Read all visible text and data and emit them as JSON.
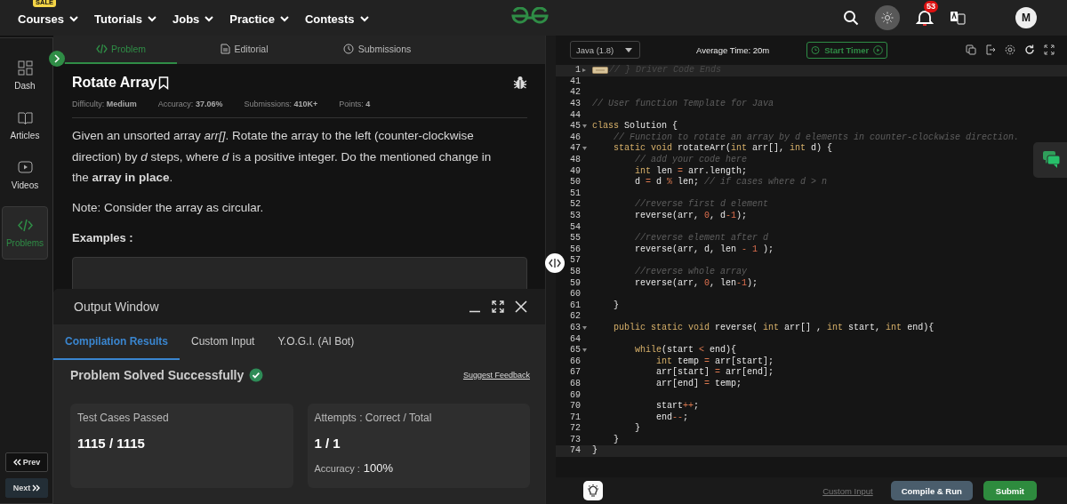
{
  "top_nav": {
    "menus": [
      {
        "label": "Courses",
        "badge": "SALE"
      },
      {
        "label": "Tutorials"
      },
      {
        "label": "Jobs"
      },
      {
        "label": "Practice"
      },
      {
        "label": "Contests"
      }
    ],
    "notification_count": "53",
    "avatar": "M"
  },
  "sidebar": {
    "items": [
      {
        "label": "Dash",
        "selected": false
      },
      {
        "label": "Articles",
        "selected": false
      },
      {
        "label": "Videos",
        "selected": false
      },
      {
        "label": "Problems",
        "selected": true
      }
    ],
    "prev": "Prev",
    "next": "Next"
  },
  "problem": {
    "tabs": [
      {
        "label": "Problem",
        "selected": true
      },
      {
        "label": "Editorial",
        "selected": false
      },
      {
        "label": "Submissions",
        "selected": false
      }
    ],
    "title": "Rotate Array",
    "meta": [
      {
        "label": "Difficulty:",
        "value": "Medium"
      },
      {
        "label": "Accuracy:",
        "value": "37.06%"
      },
      {
        "label": "Submissions:",
        "value": "410K+"
      },
      {
        "label": "Points:",
        "value": "4"
      }
    ],
    "paragraphs": [
      "Given an unsorted array *arr[]*. Rotate the array to the left (counter-clockwise direction) by *d* steps, where *d* is a positive integer. Do the mentioned change in the **array in place**.",
      "Note: Consider the array as circular."
    ],
    "examples_heading": "Examples :"
  },
  "output_window": {
    "title": "Output Window",
    "tabs": [
      {
        "label": "Compilation Results",
        "selected": true
      },
      {
        "label": "Custom Input",
        "selected": false
      },
      {
        "label": "Y.O.G.I. (AI Bot)",
        "selected": false
      }
    ],
    "status": "Problem Solved Successfully",
    "feedback_link": "Suggest Feedback",
    "cards": [
      {
        "heading": "Test Cases Passed",
        "value": "1115 / 1115"
      },
      {
        "heading": "Attempts : Correct / Total",
        "value": "1 / 1",
        "detail_label": "Accuracy :",
        "detail_value": "100%"
      }
    ]
  },
  "editor": {
    "language": "Java (1.8)",
    "average_time": "Average Time: 20m",
    "timer_button": "Start Timer",
    "lines": [
      {
        "number": "1",
        "fold": true,
        "folded": true,
        "highlighted": true,
        "tokens": [
          {
            "kind": "comment",
            "text": "// } Driver Code Ends"
          }
        ]
      },
      {
        "number": "41",
        "fold": false,
        "highlighted": false
      },
      {
        "number": "42",
        "fold": false,
        "highlighted": false
      },
      {
        "number": "43",
        "fold": false,
        "highlighted": false,
        "tokens": [
          {
            "kind": "comment",
            "text": "// User function Template for Java"
          }
        ]
      },
      {
        "number": "44",
        "fold": false,
        "highlighted": false
      },
      {
        "number": "45",
        "fold": true,
        "highlighted": false,
        "tokens": [
          {
            "kind": "keyword",
            "text": "class"
          },
          {
            "kind": "plain",
            "text": " Solution {"
          }
        ]
      },
      {
        "number": "46",
        "fold": false,
        "highlighted": false,
        "tokens": [
          {
            "kind": "comment",
            "text": "    // Function to rotate an array by d elements in counter-clockwise direction."
          }
        ]
      },
      {
        "number": "47",
        "fold": true,
        "highlighted": false,
        "tokens": [
          {
            "kind": "keyword",
            "text": "    static void"
          },
          {
            "kind": "plain",
            "text": " rotateArr("
          },
          {
            "kind": "keyword",
            "text": "int"
          },
          {
            "kind": "plain",
            "text": " arr[], "
          },
          {
            "kind": "keyword",
            "text": "int"
          },
          {
            "kind": "plain",
            "text": " d) {"
          }
        ]
      },
      {
        "number": "48",
        "fold": false,
        "highlighted": false,
        "tokens": [
          {
            "kind": "comment",
            "text": "        // add your code here"
          }
        ]
      },
      {
        "number": "49",
        "fold": false,
        "highlighted": false,
        "tokens": [
          {
            "kind": "keyword",
            "text": "        int"
          },
          {
            "kind": "plain",
            "text": " len "
          },
          {
            "kind": "operator",
            "text": "="
          },
          {
            "kind": "plain",
            "text": " arr.length;"
          }
        ]
      },
      {
        "number": "50",
        "fold": false,
        "highlighted": false,
        "tokens": [
          {
            "kind": "plain",
            "text": "        d "
          },
          {
            "kind": "operator",
            "text": "="
          },
          {
            "kind": "plain",
            "text": " d "
          },
          {
            "kind": "operator",
            "text": "%"
          },
          {
            "kind": "plain",
            "text": " len; "
          },
          {
            "kind": "comment",
            "text": "// if cases where d > n"
          }
        ]
      },
      {
        "number": "51",
        "fold": false,
        "highlighted": false
      },
      {
        "number": "52",
        "fold": false,
        "highlighted": false,
        "tokens": [
          {
            "kind": "comment",
            "text": "        //reverse first d element"
          }
        ]
      },
      {
        "number": "53",
        "fold": false,
        "highlighted": false,
        "tokens": [
          {
            "kind": "plain",
            "text": "        reverse(arr, "
          },
          {
            "kind": "number",
            "text": "0"
          },
          {
            "kind": "plain",
            "text": ", d"
          },
          {
            "kind": "operator",
            "text": "-"
          },
          {
            "kind": "number",
            "text": "1"
          },
          {
            "kind": "plain",
            "text": ");"
          }
        ]
      },
      {
        "number": "54",
        "fold": false,
        "highlighted": false
      },
      {
        "number": "55",
        "fold": false,
        "highlighted": false,
        "tokens": [
          {
            "kind": "comment",
            "text": "        //reverse element after d"
          }
        ]
      },
      {
        "number": "56",
        "fold": false,
        "highlighted": false,
        "tokens": [
          {
            "kind": "plain",
            "text": "        reverse(arr, d, len "
          },
          {
            "kind": "operator",
            "text": "-"
          },
          {
            "kind": "number",
            "text": " 1"
          },
          {
            "kind": "plain",
            "text": " );"
          }
        ]
      },
      {
        "number": "57",
        "fold": false,
        "highlighted": false
      },
      {
        "number": "58",
        "fold": false,
        "highlighted": false,
        "tokens": [
          {
            "kind": "comment",
            "text": "        //reverse whole array"
          }
        ]
      },
      {
        "number": "59",
        "fold": false,
        "highlighted": false,
        "tokens": [
          {
            "kind": "plain",
            "text": "        reverse(arr, "
          },
          {
            "kind": "number",
            "text": "0"
          },
          {
            "kind": "plain",
            "text": ", len"
          },
          {
            "kind": "operator",
            "text": "-"
          },
          {
            "kind": "number",
            "text": "1"
          },
          {
            "kind": "plain",
            "text": ");"
          }
        ]
      },
      {
        "number": "60",
        "fold": false,
        "highlighted": false
      },
      {
        "number": "61",
        "fold": false,
        "highlighted": false,
        "tokens": [
          {
            "kind": "plain",
            "text": "    }"
          }
        ]
      },
      {
        "number": "62",
        "fold": false,
        "highlighted": false
      },
      {
        "number": "63",
        "fold": true,
        "highlighted": false,
        "tokens": [
          {
            "kind": "keyword",
            "text": "    public static void"
          },
          {
            "kind": "plain",
            "text": " reverse( "
          },
          {
            "kind": "keyword",
            "text": "int"
          },
          {
            "kind": "plain",
            "text": " arr[] , "
          },
          {
            "kind": "keyword",
            "text": "int"
          },
          {
            "kind": "plain",
            "text": " start, "
          },
          {
            "kind": "keyword",
            "text": "int"
          },
          {
            "kind": "plain",
            "text": " end){"
          }
        ]
      },
      {
        "number": "64",
        "fold": false,
        "highlighted": false
      },
      {
        "number": "65",
        "fold": true,
        "highlighted": false,
        "tokens": [
          {
            "kind": "keyword",
            "text": "        while"
          },
          {
            "kind": "plain",
            "text": "(start "
          },
          {
            "kind": "operator",
            "text": "<"
          },
          {
            "kind": "plain",
            "text": " end){"
          }
        ]
      },
      {
        "number": "66",
        "fold": false,
        "highlighted": false,
        "tokens": [
          {
            "kind": "keyword",
            "text": "            int"
          },
          {
            "kind": "plain",
            "text": " temp "
          },
          {
            "kind": "operator",
            "text": "="
          },
          {
            "kind": "plain",
            "text": " arr[start];"
          }
        ]
      },
      {
        "number": "67",
        "fold": false,
        "highlighted": false,
        "tokens": [
          {
            "kind": "plain",
            "text": "            arr[start] "
          },
          {
            "kind": "operator",
            "text": "="
          },
          {
            "kind": "plain",
            "text": " arr[end];"
          }
        ]
      },
      {
        "number": "68",
        "fold": false,
        "highlighted": false,
        "tokens": [
          {
            "kind": "plain",
            "text": "            arr[end] "
          },
          {
            "kind": "operator",
            "text": "="
          },
          {
            "kind": "plain",
            "text": " temp;"
          }
        ]
      },
      {
        "number": "69",
        "fold": false,
        "highlighted": false
      },
      {
        "number": "70",
        "fold": false,
        "highlighted": false,
        "tokens": [
          {
            "kind": "plain",
            "text": "            start"
          },
          {
            "kind": "operator",
            "text": "++"
          },
          {
            "kind": "plain",
            "text": ";"
          }
        ]
      },
      {
        "number": "71",
        "fold": false,
        "highlighted": false,
        "tokens": [
          {
            "kind": "plain",
            "text": "            end"
          },
          {
            "kind": "operator",
            "text": "--"
          },
          {
            "kind": "plain",
            "text": ";"
          }
        ]
      },
      {
        "number": "72",
        "fold": false,
        "highlighted": false,
        "tokens": [
          {
            "kind": "plain",
            "text": "        }"
          }
        ]
      },
      {
        "number": "73",
        "fold": false,
        "highlighted": false,
        "tokens": [
          {
            "kind": "plain",
            "text": "    }"
          }
        ]
      },
      {
        "number": "74",
        "fold": false,
        "highlighted": true,
        "tokens": [
          {
            "kind": "plain",
            "text": "}"
          }
        ]
      }
    ],
    "custom_input": "Custom Input",
    "compile_button": "Compile & Run",
    "submit_button": "Submit"
  }
}
